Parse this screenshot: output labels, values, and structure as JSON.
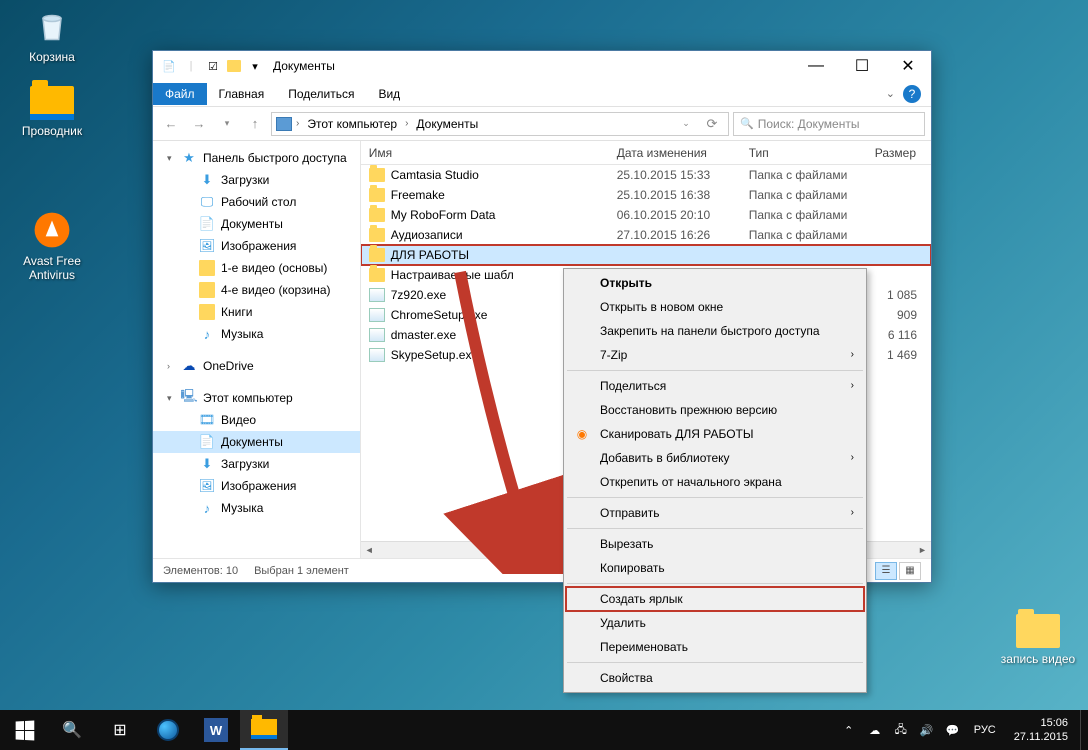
{
  "desktop": {
    "icons": [
      {
        "label": "Корзина"
      },
      {
        "label": "Проводник"
      },
      {
        "label": "Avast Free Antivirus"
      },
      {
        "label": "запись видео"
      }
    ]
  },
  "window": {
    "title": "Документы",
    "tabs": {
      "file": "Файл",
      "home": "Главная",
      "share": "Поделиться",
      "view": "Вид"
    },
    "breadcrumb": {
      "root": "Этот компьютер",
      "current": "Документы"
    },
    "search_placeholder": "Поиск: Документы",
    "columns": {
      "name": "Имя",
      "date": "Дата изменения",
      "type": "Тип",
      "size": "Размер"
    },
    "nav": {
      "quick": "Панель быстрого доступа",
      "downloads": "Загрузки",
      "desktop": "Рабочий стол",
      "documents": "Документы",
      "pictures": "Изображения",
      "vid1": "1-е видео (основы)",
      "vid4": "4-е видео (корзина)",
      "books": "Книги",
      "music": "Музыка",
      "onedrive": "OneDrive",
      "thispc": "Этот компьютер",
      "video": "Видео",
      "documents2": "Документы",
      "downloads2": "Загрузки",
      "pictures2": "Изображения",
      "music2": "Музыка"
    },
    "files": [
      {
        "name": "Camtasia Studio",
        "date": "25.10.2015 15:33",
        "type": "Папка с файлами",
        "size": "",
        "kind": "folder"
      },
      {
        "name": "Freemake",
        "date": "25.10.2015 16:38",
        "type": "Папка с файлами",
        "size": "",
        "kind": "folder"
      },
      {
        "name": "My RoboForm Data",
        "date": "06.10.2015 20:10",
        "type": "Папка с файлами",
        "size": "",
        "kind": "folder"
      },
      {
        "name": "Аудиозаписи",
        "date": "27.10.2015 16:26",
        "type": "Папка с файлами",
        "size": "",
        "kind": "folder"
      },
      {
        "name": "ДЛЯ РАБОТЫ",
        "date": "",
        "type": "",
        "size": "",
        "kind": "folder",
        "selected": true
      },
      {
        "name": "Настраиваемые шабл",
        "date": "",
        "type": "",
        "size": "",
        "kind": "folder"
      },
      {
        "name": "7z920.exe",
        "date": "",
        "type": "",
        "size": "1 085",
        "kind": "exe"
      },
      {
        "name": "ChromeSetup.exe",
        "date": "",
        "type": "",
        "size": "909",
        "kind": "exe"
      },
      {
        "name": "dmaster.exe",
        "date": "",
        "type": "",
        "size": "6 116",
        "kind": "exe"
      },
      {
        "name": "SkypeSetup.exe",
        "date": "",
        "type": "",
        "size": "1 469",
        "kind": "exe"
      }
    ],
    "status": {
      "count": "Элементов: 10",
      "sel": "Выбран 1 элемент"
    }
  },
  "context_menu": {
    "open": "Открыть",
    "open_new": "Открыть в новом окне",
    "pin_quick": "Закрепить на панели быстрого доступа",
    "sevenzip": "7-Zip",
    "share": "Поделиться",
    "restore": "Восстановить прежнюю версию",
    "scan": "Сканировать ДЛЯ РАБОТЫ",
    "library": "Добавить в библиотеку",
    "unpin_start": "Открепить от начального экрана",
    "send": "Отправить",
    "cut": "Вырезать",
    "copy": "Копировать",
    "shortcut": "Создать ярлык",
    "delete": "Удалить",
    "rename": "Переименовать",
    "props": "Свойства"
  },
  "taskbar": {
    "lang": "РУС",
    "time": "15:06",
    "date": "27.11.2015"
  }
}
